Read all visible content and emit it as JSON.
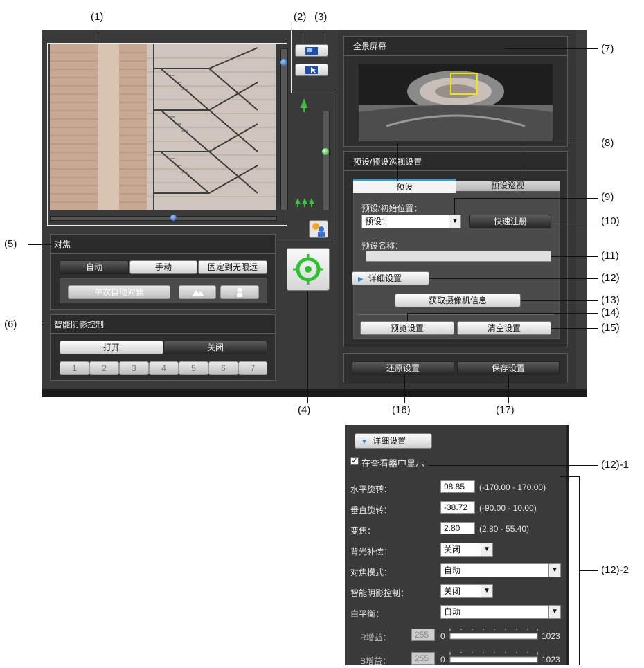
{
  "callouts": {
    "c1": "(1)",
    "c2": "(2)",
    "c3": "(3)",
    "c4": "(4)",
    "c5": "(5)",
    "c6": "(6)",
    "c7": "(7)",
    "c8": "(8)",
    "c9": "(9)",
    "c10": "(10)",
    "c11": "(11)",
    "c12": "(12)",
    "c13": "(13)",
    "c14": "(14)",
    "c15": "(15)",
    "c16": "(16)",
    "c17": "(17)",
    "c12_1": "(12)-1",
    "c12_2": "(12)-2"
  },
  "focus": {
    "title": "对焦",
    "auto": "自动",
    "manual": "手动",
    "fixed": "固定到无限远",
    "one_shot": "单次自动对焦"
  },
  "shadow": {
    "title": "智能阴影控制",
    "on": "打开",
    "off": "关闭",
    "levels": [
      "1",
      "2",
      "3",
      "4",
      "5",
      "6",
      "7"
    ]
  },
  "panorama": {
    "title": "全景屏幕"
  },
  "preset": {
    "section_title": "预设/预设巡视设置",
    "tab_preset": "预设",
    "tab_tour": "预设巡视",
    "position_label": "预设/初始位置：",
    "position_value": "预设1",
    "quick_register": "快速注册",
    "name_label": "预设名称：",
    "name_value": "",
    "details": "详细设置",
    "get_info": "获取摄像机信息",
    "preview": "预览设置",
    "clear": "清空设置"
  },
  "footer": {
    "restore": "还原设置",
    "save": "保存设置"
  },
  "details_panel": {
    "header": "详细设置",
    "show_in_viewer": "在查看器中显示",
    "show_checked": true,
    "pan_label": "水平旋转：",
    "pan_value": "98.85",
    "pan_range": "(-170.00 - 170.00)",
    "tilt_label": "垂直旋转：",
    "tilt_value": "-38.72",
    "tilt_range": "(-90.00 - 10.00)",
    "zoom_label": "变焦：",
    "zoom_value": "2.80",
    "zoom_range": "(2.80 - 55.40)",
    "backlight_label": "背光补偿：",
    "backlight_value": "关闭",
    "focus_mode_label": "对焦模式：",
    "focus_mode_value": "自动",
    "shadow_label": "智能阴影控制：",
    "shadow_value": "关闭",
    "wb_label": "白平衡：",
    "wb_value": "自动",
    "r_gain_label": "R增益：",
    "r_gain_value": "255",
    "r_gain_min": "0",
    "r_gain_max": "1023",
    "b_gain_label": "B增益：",
    "b_gain_value": "255",
    "b_gain_min": "0",
    "b_gain_max": "1023"
  }
}
